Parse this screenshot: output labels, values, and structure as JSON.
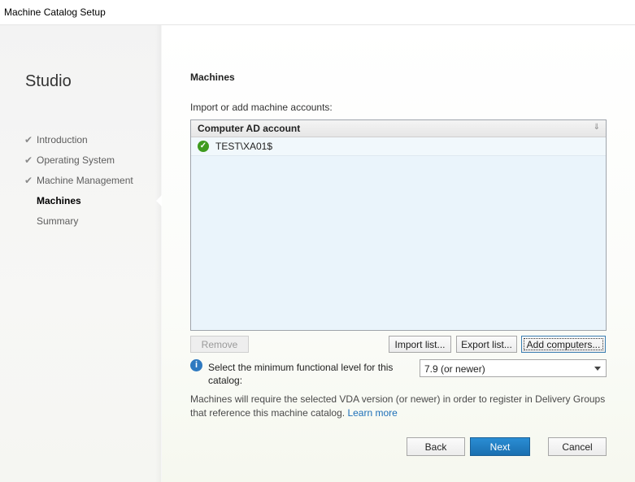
{
  "window": {
    "title": "Machine Catalog Setup"
  },
  "sidebar": {
    "brand": "Studio",
    "steps": [
      {
        "label": "Introduction",
        "done": true
      },
      {
        "label": "Operating System",
        "done": true
      },
      {
        "label": "Machine Management",
        "done": true
      },
      {
        "label": "Machines",
        "done": false,
        "active": true
      },
      {
        "label": "Summary",
        "done": false
      }
    ],
    "check_glyph": "✔"
  },
  "main": {
    "heading": "Machines",
    "subheading": "Import or add machine accounts:",
    "table": {
      "column": "Computer AD account",
      "sort_glyph": "⇓",
      "rows": [
        {
          "account": "TEST\\XA01$",
          "status": "ok"
        }
      ]
    },
    "buttons": {
      "remove": "Remove",
      "import": "Import list...",
      "export": "Export list...",
      "add": "Add computers..."
    },
    "level": {
      "label": "Select the minimum functional level for this catalog:",
      "selected": "7.9 (or newer)"
    },
    "note": "Machines will require the selected VDA version (or newer) in order to register in Delivery Groups that reference this machine catalog.",
    "learn_more": "Learn more"
  },
  "footer": {
    "back": "Back",
    "next": "Next",
    "cancel": "Cancel"
  },
  "colors": {
    "accent": "#1a6fb0",
    "success": "#3f9b1e",
    "info": "#2e79c0"
  }
}
